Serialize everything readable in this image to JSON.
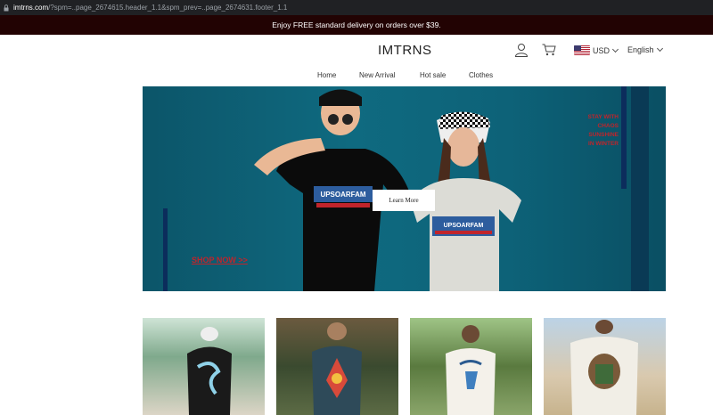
{
  "browser": {
    "url_domain": "imtrns.com",
    "url_rest": "/?spm=..page_2674615.header_1.1&spm_prev=..page_2674631.footer_1.1"
  },
  "promo": {
    "text": "Enjoy FREE standard delivery on orders over $39."
  },
  "header": {
    "logo": "IMTRNS",
    "currency": "USD",
    "language": "English"
  },
  "nav": {
    "items": [
      "Home",
      "New Arrival",
      "Hot sale",
      "Clothes"
    ]
  },
  "hero": {
    "red_text_lines": [
      "STAY WITH",
      "CHAOS",
      "SUNSHINE",
      "IN WINTER"
    ],
    "shop_now": "SHOP NOW >>",
    "learn_more": "Learn More",
    "shirt_text_1": "UPSOARFAM",
    "shirt_text_2": "UPSOARFAM"
  },
  "colors": {
    "promo_bg": "#220303",
    "hero_bg": "#0f6a80",
    "accent_red": "#c0242b"
  },
  "products": [
    {
      "name": "product-card-1"
    },
    {
      "name": "product-card-2"
    },
    {
      "name": "product-card-3"
    },
    {
      "name": "product-card-4"
    }
  ]
}
